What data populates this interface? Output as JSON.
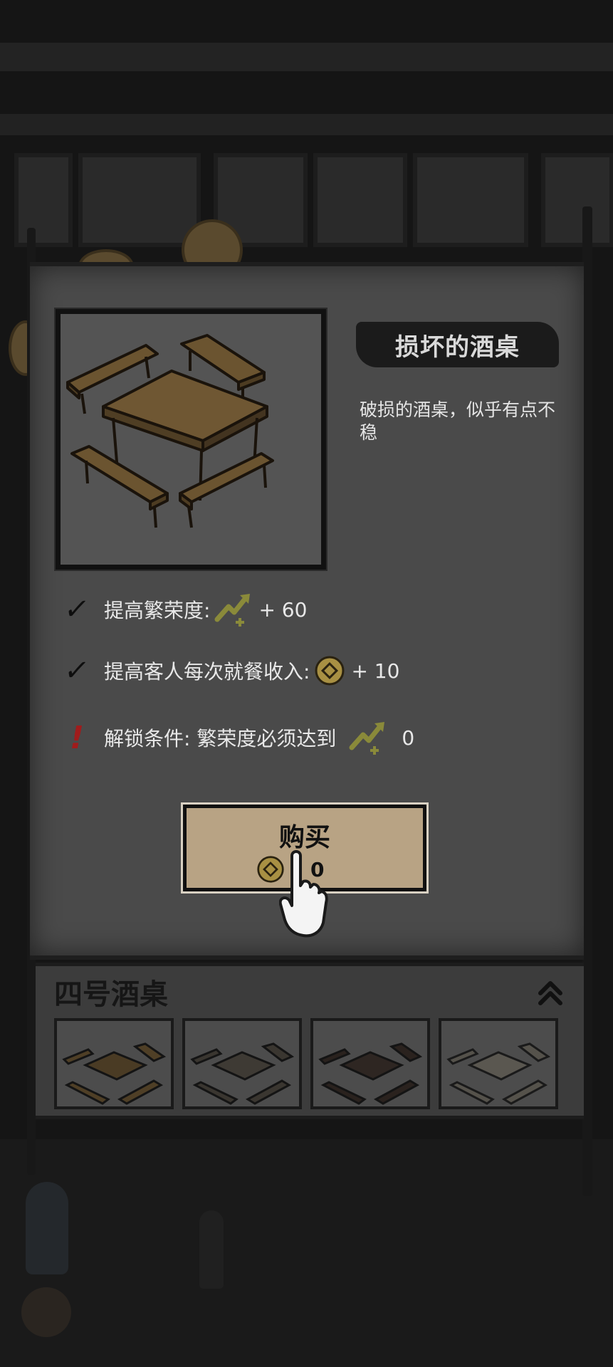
{
  "item": {
    "name": "损坏的酒桌",
    "description": "破损的酒桌，似乎有点不稳",
    "image_icon": "wooden-table-with-benches-icon"
  },
  "effects": [
    {
      "label": "提高繁荣度:",
      "icon": "prosperity-arrow-icon",
      "value": "+ 60"
    },
    {
      "label": "提高客人每次就餐收入:",
      "icon": "coin-icon",
      "value": "+ 10"
    }
  ],
  "unlock": {
    "label": "解锁条件: 繁荣度必须达到",
    "icon": "prosperity-arrow-icon",
    "value": "0"
  },
  "buy": {
    "label": "购买",
    "cost": "0",
    "cost_icon": "coin-icon"
  },
  "table_selector": {
    "title": "四号酒桌",
    "collapse_icon": "double-chevron-up-icon",
    "thumbnails": [
      {
        "icon": "table-variant-1-icon"
      },
      {
        "icon": "table-variant-2-icon"
      },
      {
        "icon": "table-variant-3-icon"
      },
      {
        "icon": "table-variant-4-icon"
      }
    ]
  },
  "colors": {
    "panel": "#4a4a4a",
    "button": "#b8a384",
    "prosperity": "#8a8a3a",
    "coin": "#a89043",
    "warning": "#a01c1c"
  }
}
